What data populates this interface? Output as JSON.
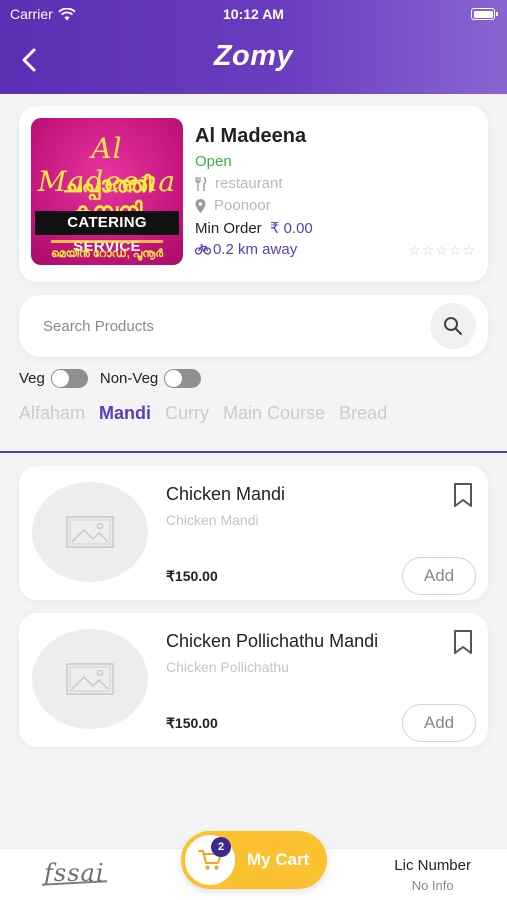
{
  "status_bar": {
    "carrier": "Carrier",
    "time": "10:12 AM"
  },
  "header": {
    "title": "Zomy",
    "back_icon": "chevron-left-icon"
  },
  "store": {
    "name": "Al Madeena",
    "status": "Open",
    "category": "restaurant",
    "location": "Poonoor",
    "min_order_label": "Min Order",
    "min_order_value": "₹ 0.00",
    "distance": "0.2 km away",
    "rating_stars": "☆☆☆☆☆",
    "logo": {
      "line1": "Al Madeena",
      "line2": "ചപ്പാത്തി കമ്പനി",
      "line3": "CATERING SERVICE",
      "line4": "മെയിൻ റോഡ്, പൂനൂർ"
    },
    "status_color": "#3cb04a",
    "accent_color": "#5b3eb8"
  },
  "search": {
    "placeholder": "Search Products",
    "icon": "search-icon"
  },
  "filters": {
    "veg_label": "Veg",
    "nonveg_label": "Non-Veg",
    "veg_on": false,
    "nonveg_on": false
  },
  "tabs": [
    {
      "label": "Alfaham",
      "active": false
    },
    {
      "label": "Mandi",
      "active": true
    },
    {
      "label": "Curry",
      "active": false
    },
    {
      "label": "Main Course",
      "active": false
    },
    {
      "label": "Bread",
      "active": false
    }
  ],
  "products": [
    {
      "name": "Chicken Mandi",
      "description": "Chicken Mandi",
      "price": "₹150.00",
      "add_label": "Add"
    },
    {
      "name": "Chicken Pollichathu Mandi",
      "description": "Chicken Pollichathu",
      "price": "₹150.00",
      "add_label": "Add"
    }
  ],
  "bottom_bar": {
    "fssai_logo_text": "fssai",
    "lic_label": "Lic Number",
    "lic_value": "No Info",
    "cart_label": "My Cart",
    "cart_count": "2",
    "cart_color": "#fbc131"
  }
}
